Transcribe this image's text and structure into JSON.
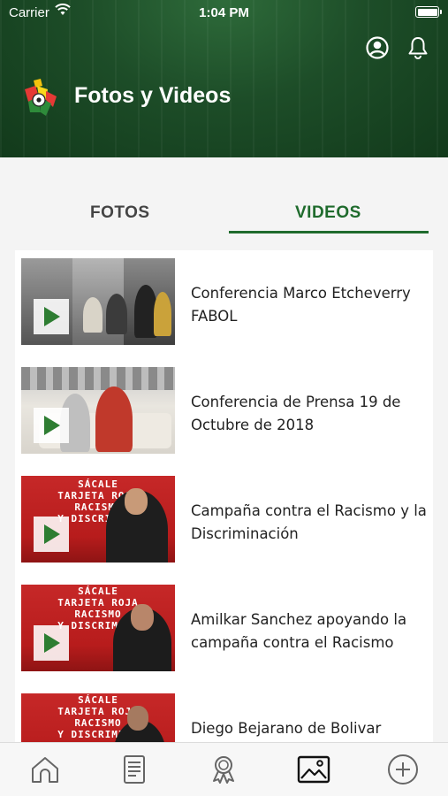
{
  "status_bar": {
    "carrier": "Carrier",
    "time": "1:04 PM"
  },
  "header": {
    "title": "Fotos y Videos",
    "background_color": "#1d4d28",
    "icons": [
      "user-circle-icon",
      "bell-icon"
    ]
  },
  "tabs": {
    "items": [
      {
        "label": "FOTOS",
        "selected": false
      },
      {
        "label": "VIDEOS",
        "selected": true
      }
    ],
    "accent_color": "#1f6b2d"
  },
  "videos": [
    {
      "title": "Conferencia Marco Etcheverry FABOL"
    },
    {
      "title": "Conferencia de Prensa 19 de Octubre de 2018"
    },
    {
      "title": "Campaña contra el Racismo y la Discriminación",
      "banner": [
        "SÁCALE",
        "TARJETA ROJA",
        "RACISMO",
        "Y DISCRIMINA"
      ]
    },
    {
      "title": "Amilkar Sanchez apoyando la campaña contra el Racismo",
      "banner": [
        "SÁCALE",
        "TARJETA ROJA",
        "RACISMO",
        "Y DISCRIMINA"
      ]
    },
    {
      "title": "Diego Bejarano de Bolivar",
      "banner": [
        "SÁCALE",
        "TARJETA ROJA",
        "RACISMO",
        "Y DISCRIMINA"
      ]
    }
  ],
  "bottom_nav": {
    "items": [
      {
        "icon": "home-icon",
        "active": false
      },
      {
        "icon": "document-icon",
        "active": false
      },
      {
        "icon": "award-icon",
        "active": false
      },
      {
        "icon": "image-gallery-icon",
        "active": true
      },
      {
        "icon": "plus-circle-icon",
        "active": false
      }
    ]
  }
}
